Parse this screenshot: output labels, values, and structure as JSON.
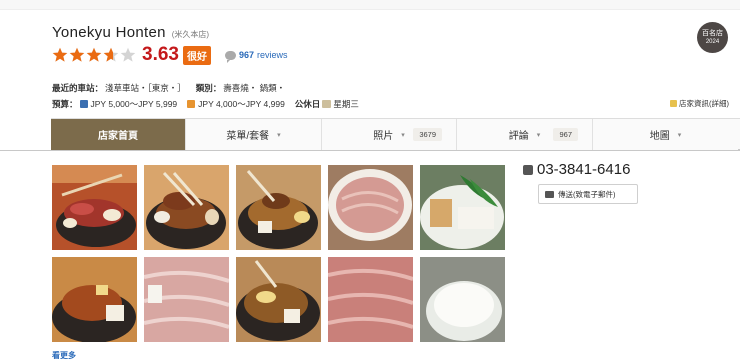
{
  "restaurant": {
    "name": "Yonekyu Honten",
    "name_sub": "(米久本店)",
    "rating": "3.63",
    "rating_value": 3.63,
    "stars_filled_fraction": 0.63,
    "rating_badge": "很好",
    "review_count": "967",
    "review_label": "reviews",
    "award": {
      "line1": "百名店",
      "line2": "2024"
    }
  },
  "info": {
    "station_label": "最近的車站：",
    "station_value": "淺草車站・［東京・］",
    "genre_label": "類別：",
    "genre_value": "壽喜燒・ 鍋類・",
    "budget_label": "預算：",
    "dinner_budget": "JPY 5,000～JPY 5,999",
    "lunch_budget": "JPY 4,000～JPY 4,999",
    "closed_label": "公休日",
    "closed_value": "星期三",
    "store_info_link": "店家資訊(詳細)"
  },
  "tabs": [
    {
      "label": "店家首頁",
      "count": "",
      "active": true
    },
    {
      "label": "菜單/套餐",
      "count": "",
      "active": false
    },
    {
      "label": "照片",
      "count": "3679",
      "active": false
    },
    {
      "label": "評論",
      "count": "967",
      "active": false
    },
    {
      "label": "地圖",
      "count": "",
      "active": false
    }
  ],
  "contact": {
    "phone": "03-3841-6416",
    "send_label": "傳送(致電子郵件)"
  },
  "photos_more": "看更多",
  "colors": {
    "tab_active": "#7c6b4b",
    "score_red": "#c4191b",
    "badge_orange": "#ea6b12",
    "link_blue": "#2a6ab9",
    "star_orange": "#ea6b12"
  }
}
